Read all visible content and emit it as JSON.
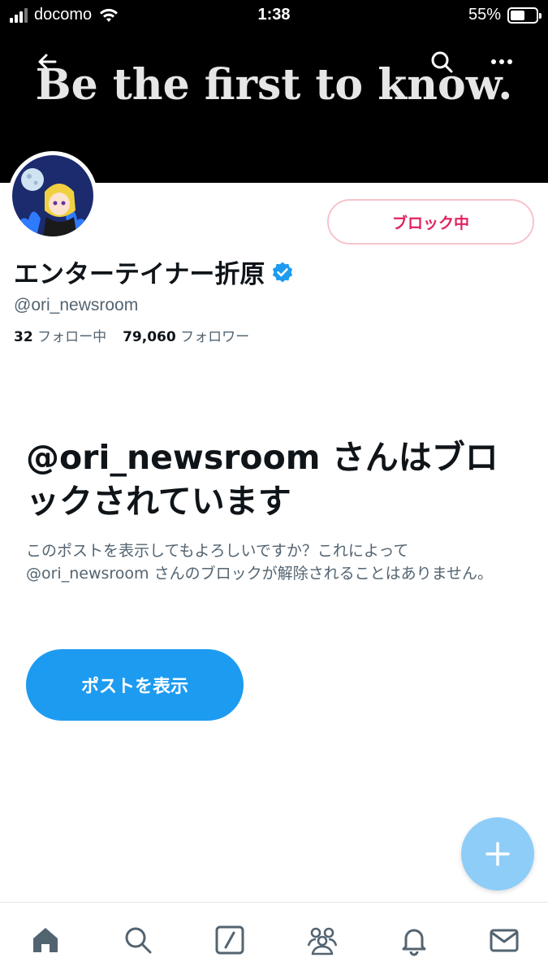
{
  "status_bar": {
    "carrier": "docomo",
    "time": "1:38",
    "battery_text": "55%",
    "battery_level": 0.55
  },
  "header": {
    "banner_text": "Be the first to know.",
    "icons": [
      "back-arrow-icon",
      "search-icon",
      "more-icon"
    ]
  },
  "profile": {
    "display_name": "エンターテイナー折原",
    "handle": "@ori_newsroom",
    "following_count": "32",
    "following_label": "フォロー中",
    "followers_count": "79,060",
    "followers_label": "フォロワー",
    "block_button_label": "ブロック中",
    "verified": true
  },
  "blocked_notice": {
    "title": "@ori_newsroom さんはブロックされています",
    "description": "このポストを表示してもよろしいですか？これによって @ori_newsroom さんのブロックが解除されることはありません。",
    "show_button_label": "ポストを表示"
  },
  "tabbar": {
    "items": [
      "home-icon",
      "search-icon",
      "compose-slash-icon",
      "communities-icon",
      "notifications-icon",
      "messages-icon"
    ]
  },
  "colors": {
    "brand_blue": "#1d9bf0",
    "fab_blue": "#8ecdf8",
    "block_red": "#e0245e",
    "banner_bg": "#000000"
  }
}
